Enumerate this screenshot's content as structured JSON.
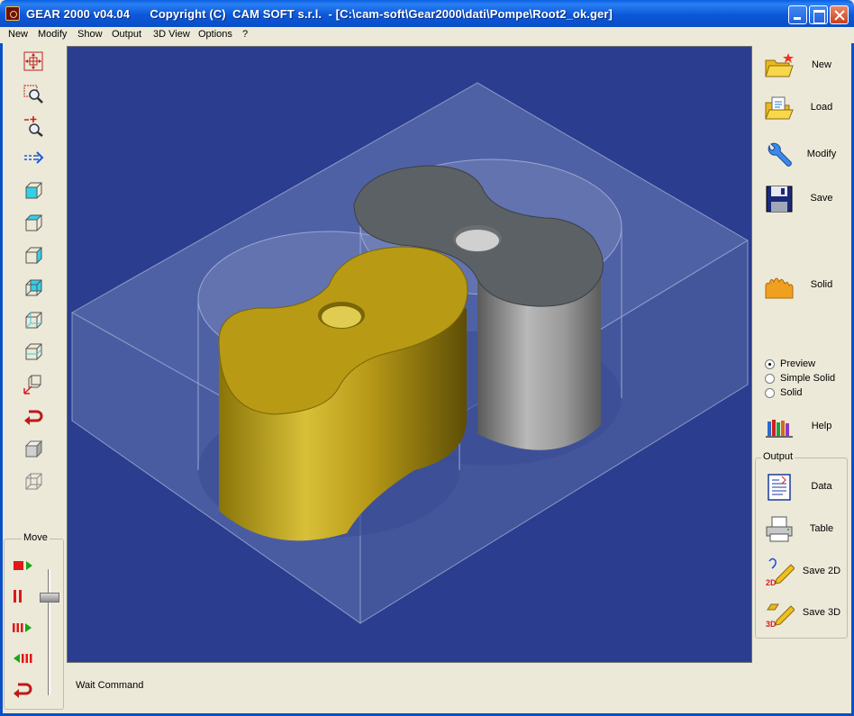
{
  "window": {
    "title": "GEAR 2000 v04.04      Copyright (C)  CAM SOFT s.r.l.  - [C:\\cam-soft\\Gear2000\\dati\\Pompe\\Root2_ok.ger]"
  },
  "menu": [
    {
      "label": "New"
    },
    {
      "label": "Modify"
    },
    {
      "label": "Show"
    },
    {
      "label": "Output"
    },
    {
      "label": "3D View"
    },
    {
      "label": "Options"
    },
    {
      "label": "?"
    }
  ],
  "left_toolbar": {
    "move_label": "Move"
  },
  "right_panel": {
    "new": "New",
    "load": "Load",
    "modify": "Modify",
    "save": "Save",
    "solid": "Solid",
    "help": "Help",
    "render_modes": [
      {
        "label": "Preview",
        "selected": true
      },
      {
        "label": "Simple Solid",
        "selected": false
      },
      {
        "label": "Solid",
        "selected": false
      }
    ],
    "output_group": {
      "legend": "Output",
      "data": "Data",
      "table": "Table",
      "save2d": "Save 2D",
      "save3d": "Save 3D"
    }
  },
  "status": "Wait Command",
  "colors": {
    "viewport_bg": "#2a3d8f",
    "gear_yellow": "#c8a820",
    "gear_gray": "#8a8a8a"
  }
}
